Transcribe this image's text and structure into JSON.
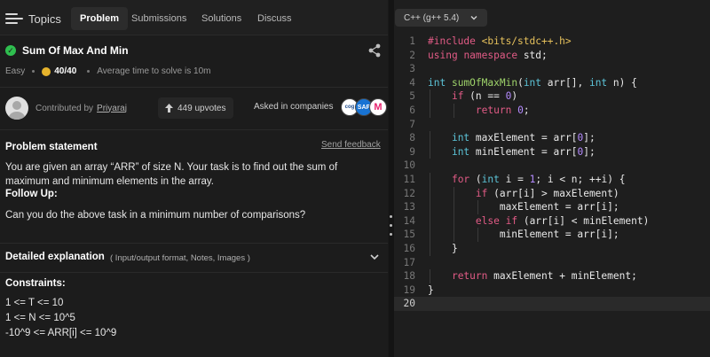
{
  "nav": {
    "topics_label": "Topics",
    "tabs": [
      "Problem",
      "Submissions",
      "Solutions",
      "Discuss"
    ]
  },
  "problem": {
    "title": "Sum Of Max And Min",
    "difficulty": "Easy",
    "score": "40/40",
    "avg_time": "Average time to solve is 10m",
    "contributed_label": "Contributed by",
    "author": "Priyaraj",
    "upvotes": "449 upvotes",
    "asked_label": "Asked in companies",
    "company_logos": [
      "cognizant-icon",
      "sap-icon",
      "myntra-icon"
    ],
    "statement_heading": "Problem statement",
    "send_feedback": "Send feedback",
    "statement": "You are given an array “ARR” of size N. Your task is to find out the sum of maximum and minimum elements in the array.",
    "follow_up_heading": "Follow Up:",
    "follow_up": "Can you do the above task in a minimum number of comparisons?",
    "detail_heading": "Detailed explanation",
    "detail_sub": "( Input/output format, Notes, Images )",
    "constraints_heading": "Constraints:",
    "constraints": [
      "1 <= T <= 10",
      "1 <= N <= 10^5",
      "-10^9 <= ARR[i] <= 10^9"
    ]
  },
  "editor": {
    "language": "C++ (g++ 5.4)",
    "current_line": 20,
    "lines": [
      "#include <bits/stdc++.h>",
      "using namespace std;",
      "",
      "int sumOfMaxMin(int arr[], int n) {",
      "    if (n == 0)",
      "        return 0;",
      "",
      "    int maxElement = arr[0];",
      "    int minElement = arr[0];",
      "",
      "    for (int i = 1; i < n; ++i) {",
      "        if (arr[i] > maxElement)",
      "            maxElement = arr[i];",
      "        else if (arr[i] < minElement)",
      "            minElement = arr[i];",
      "    }",
      "",
      "    return maxElement + minElement;",
      "}",
      ""
    ]
  },
  "colors": {
    "keyword": "#e25b86",
    "type": "#5cc4d8",
    "function": "#9ed36a",
    "number": "#b58bff",
    "include": "#e6c15c",
    "success": "#2fbf4f"
  }
}
